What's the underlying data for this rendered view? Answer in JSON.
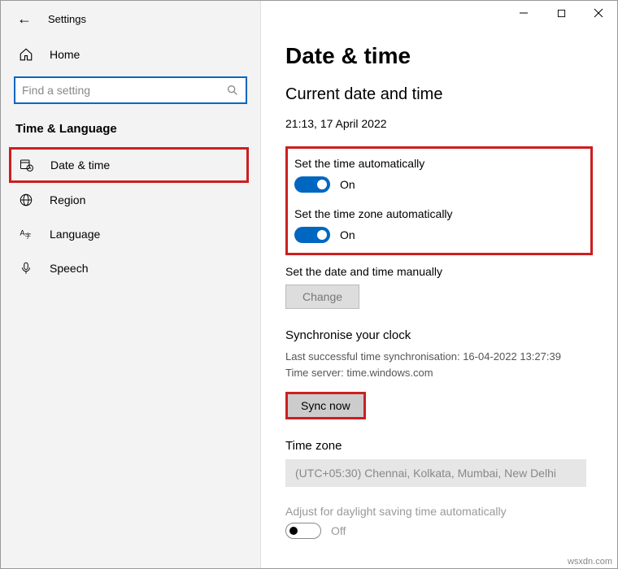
{
  "window": {
    "title": "Settings"
  },
  "sidebar": {
    "home": "Home",
    "search_placeholder": "Find a setting",
    "category": "Time & Language",
    "items": [
      {
        "label": "Date & time"
      },
      {
        "label": "Region"
      },
      {
        "label": "Language"
      },
      {
        "label": "Speech"
      }
    ]
  },
  "page": {
    "title": "Date & time",
    "section": "Current date and time",
    "now": "21:13, 17 April 2022",
    "auto_time_label": "Set the time automatically",
    "auto_time_state": "On",
    "auto_tz_label": "Set the time zone automatically",
    "auto_tz_state": "On",
    "manual_label": "Set the date and time manually",
    "change": "Change",
    "sync_title": "Synchronise your clock",
    "sync_last": "Last successful time synchronisation: 16-04-2022 13:27:39",
    "sync_server": "Time server: time.windows.com",
    "sync_btn": "Sync now",
    "tz_title": "Time zone",
    "tz_value": "(UTC+05:30) Chennai, Kolkata, Mumbai, New Delhi",
    "dst_label": "Adjust for daylight saving time automatically",
    "dst_state": "Off"
  },
  "attribution": "wsxdn.com"
}
